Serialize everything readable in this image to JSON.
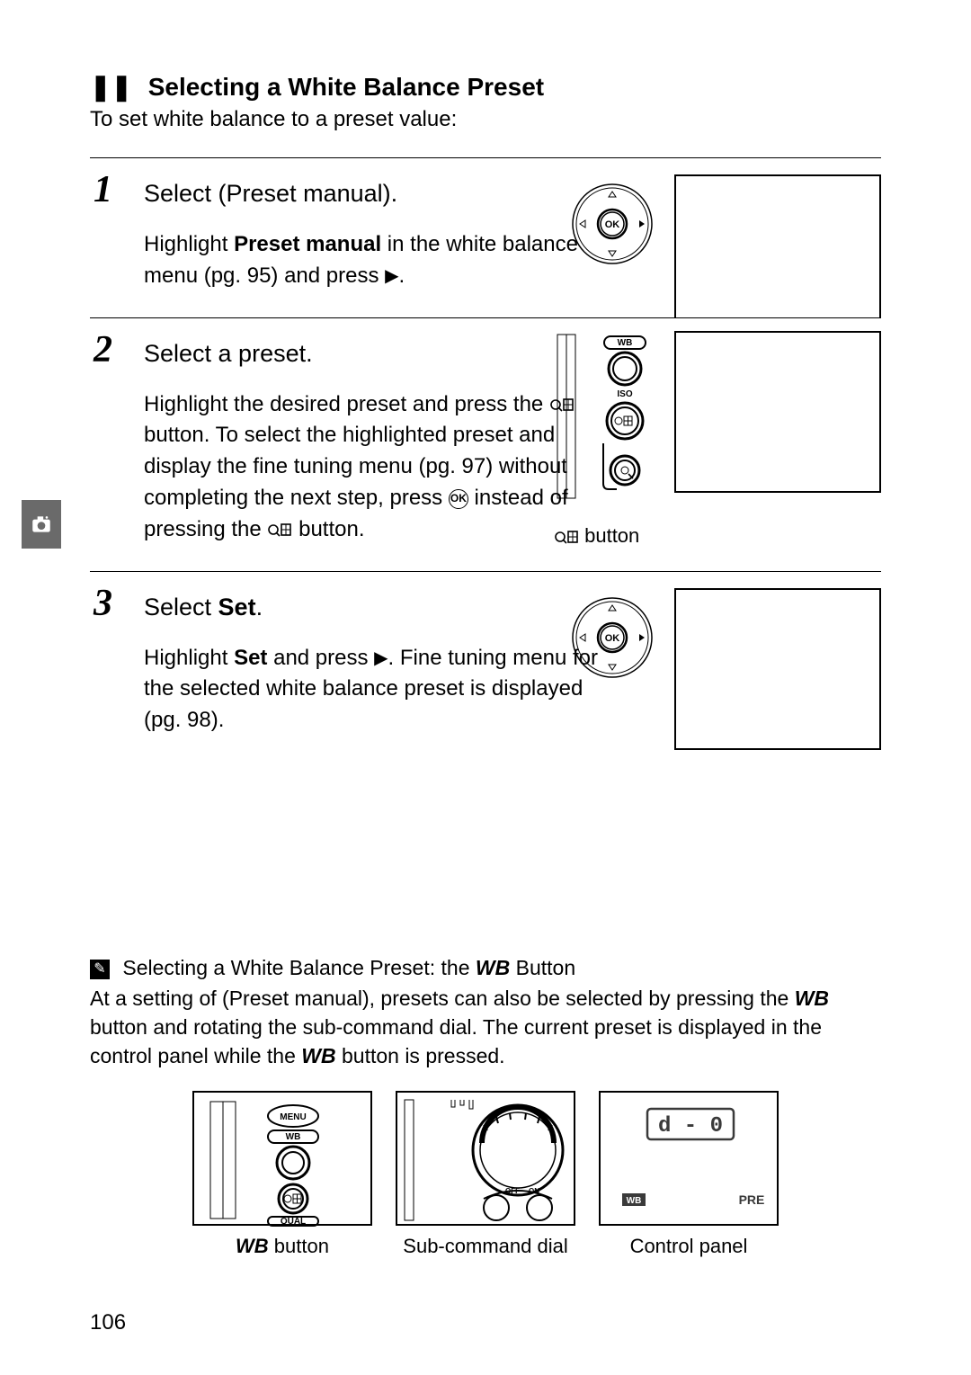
{
  "heading": {
    "glyph": "❚❚",
    "text": "Selecting a White Balance Preset"
  },
  "intro": "To set white balance to a preset value:",
  "steps": [
    {
      "num": "1",
      "title_a": "Select ",
      "title_b": " (Preset manual).",
      "body_a": "Highlight ",
      "body_b": "Preset manual",
      "body_c": " in the white balance menu (pg. 95) and press ",
      "body_d": "."
    },
    {
      "num": "2",
      "title_a": "Select a preset.",
      "body_a": "Highlight the desired preset and press the ",
      "body_b": " button.  To select the highlighted preset and display the fine tuning menu (pg. 97) without completing the next step, press ",
      "body_c": " instead of pressing the ",
      "body_d": " button.",
      "caption_a": " button"
    },
    {
      "num": "3",
      "title_a": "Select ",
      "title_b": "Set",
      "title_c": ".",
      "body_a": "Highlight ",
      "body_b": "Set",
      "body_c": " and press ",
      "body_d": ".  Fine tuning menu for the selected white balance preset is displayed (pg. 98)."
    }
  ],
  "note": {
    "title_a": "Selecting a White Balance Preset: the ",
    "title_wb": "WB",
    "title_b": " Button",
    "body_a": "At a setting of ",
    "body_b": " (Preset manual), presets can also be selected by pressing the ",
    "body_wb1": "WB",
    "body_c": " button and rotating the sub-command dial.  The current preset is displayed in the control panel while the ",
    "body_wb2": "WB",
    "body_d": " button is pressed."
  },
  "fig_captions": {
    "wb_button_a": "WB",
    "wb_button_b": " button",
    "sub_dial": "Sub-command dial",
    "control_panel": "Control panel"
  },
  "lcd": {
    "top": "d - 0",
    "bl": "WB",
    "br": "PRE"
  },
  "dpad_ok": "OK",
  "page_number": "106",
  "icon_labels": {
    "wb": "WB",
    "iso": "ISO",
    "menu": "MENU",
    "qual": "QUAL"
  }
}
